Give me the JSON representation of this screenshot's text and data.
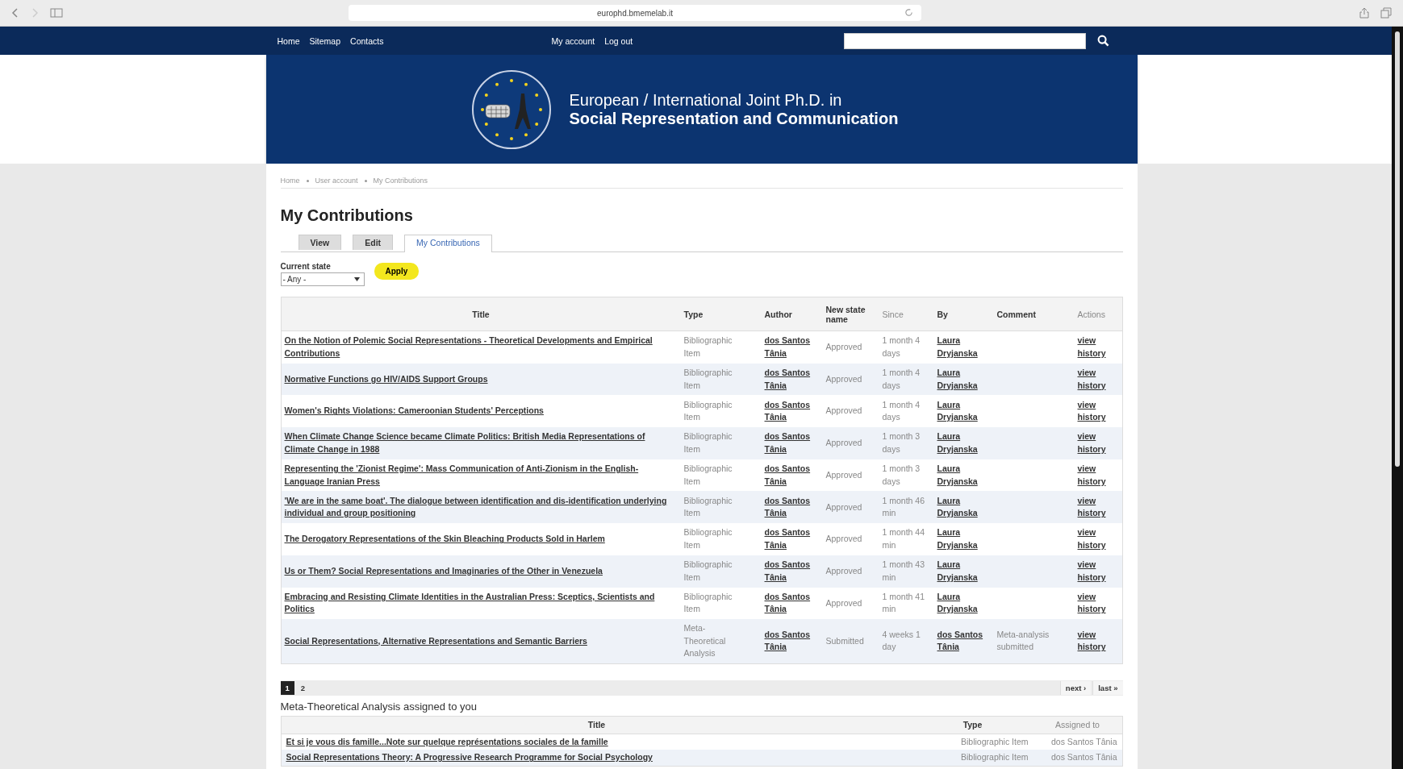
{
  "browser": {
    "url": "europhd.bmemelab.it"
  },
  "nav": {
    "links": [
      "Home",
      "Sitemap",
      "Contacts"
    ],
    "account_links": [
      "My account",
      "Log out"
    ]
  },
  "header": {
    "line1": "European / International Joint Ph.D. in",
    "line2": "Social Representation and Communication"
  },
  "breadcrumb": [
    "Home",
    "User account",
    "My Contributions"
  ],
  "page_title": "My Contributions",
  "tabs": [
    {
      "label": "View",
      "selected": false
    },
    {
      "label": "Edit",
      "selected": false
    },
    {
      "label": "My Contributions",
      "selected": true
    }
  ],
  "filter": {
    "label": "Current state",
    "value": "- Any -",
    "button": "Apply"
  },
  "contributions": {
    "columns": [
      {
        "label": "Title",
        "bold": true
      },
      {
        "label": "Type",
        "bold": true
      },
      {
        "label": "Author",
        "bold": true
      },
      {
        "label": "New state name",
        "bold": true
      },
      {
        "label": "Since",
        "bold": false
      },
      {
        "label": "By",
        "bold": true
      },
      {
        "label": "Comment",
        "bold": true
      },
      {
        "label": "Actions",
        "bold": false
      }
    ],
    "rows": [
      {
        "title": "On the Notion of Polemic Social Representations - Theoretical Developments and Empirical Contributions",
        "type": "Bibliographic Item",
        "author": "dos Santos Tânia",
        "state": "Approved",
        "since": "1 month 4 days",
        "by": "Laura Dryjanska",
        "comment": "",
        "action": "view history"
      },
      {
        "title": "Normative Functions go HIV/AIDS Support Groups",
        "type": "Bibliographic Item",
        "author": "dos Santos Tânia",
        "state": "Approved",
        "since": "1 month 4 days",
        "by": "Laura Dryjanska",
        "comment": "",
        "action": "view history"
      },
      {
        "title": "Women's Rights Violations: Cameroonian Students' Perceptions",
        "type": "Bibliographic Item",
        "author": "dos Santos Tânia",
        "state": "Approved",
        "since": "1 month 4 days",
        "by": "Laura Dryjanska",
        "comment": "",
        "action": "view history"
      },
      {
        "title": "When Climate Change Science became Climate Politics: British Media Representations of Climate Change in 1988",
        "type": "Bibliographic Item",
        "author": "dos Santos Tânia",
        "state": "Approved",
        "since": "1 month 3 days",
        "by": "Laura Dryjanska",
        "comment": "",
        "action": "view history"
      },
      {
        "title": "Representing the 'Zionist Regime': Mass Communication of Anti-Zionism in the English-Language Iranian Press",
        "type": "Bibliographic Item",
        "author": "dos Santos Tânia",
        "state": "Approved",
        "since": "1 month 3 days",
        "by": "Laura Dryjanska",
        "comment": "",
        "action": "view history"
      },
      {
        "title": "'We are in the same boat'. The dialogue between identification and dis-identification underlying individual and group positioning",
        "type": "Bibliographic Item",
        "author": "dos Santos Tânia",
        "state": "Approved",
        "since": "1 month 46 min",
        "by": "Laura Dryjanska",
        "comment": "",
        "action": "view history"
      },
      {
        "title": "The Derogatory Representations of the Skin Bleaching Products Sold in Harlem",
        "type": "Bibliographic Item",
        "author": "dos Santos Tânia",
        "state": "Approved",
        "since": "1 month 44 min",
        "by": "Laura Dryjanska",
        "comment": "",
        "action": "view history"
      },
      {
        "title": "Us or Them? Social Representations and Imaginaries of the Other in Venezuela",
        "type": "Bibliographic Item",
        "author": "dos Santos Tânia",
        "state": "Approved",
        "since": "1 month 43 min",
        "by": "Laura Dryjanska",
        "comment": "",
        "action": "view history"
      },
      {
        "title": "Embracing and Resisting Climate Identities in the Australian Press: Sceptics, Scientists and Politics",
        "type": "Bibliographic Item",
        "author": "dos Santos Tânia",
        "state": "Approved",
        "since": "1 month 41 min",
        "by": "Laura Dryjanska",
        "comment": "",
        "action": "view history"
      },
      {
        "title": "Social Representations, Alternative Representations and Semantic Barriers",
        "type": "Meta-Theoretical Analysis",
        "author": "dos Santos Tânia",
        "state": "Submitted",
        "since": "4 weeks 1 day",
        "by": "dos Santos Tânia",
        "comment": "Meta-analysis submitted",
        "action": "view history"
      }
    ]
  },
  "pager": {
    "pages": [
      {
        "label": "1",
        "selected": true
      },
      {
        "label": "2",
        "selected": false
      }
    ],
    "next": "next ›",
    "last": "last »"
  },
  "assigned": {
    "heading": "Meta-Theoretical Analysis assigned to you",
    "columns": [
      {
        "label": "Title",
        "bold": true
      },
      {
        "label": "Type",
        "bold": true
      },
      {
        "label": "Assigned to",
        "bold": false
      }
    ],
    "rows": [
      {
        "title": "Et si je vous dis famille...Note sur quelque représentations sociales de la famille",
        "type": "Bibliographic Item",
        "assigned_to": "dos Santos Tânia"
      },
      {
        "title": "Social Representations Theory: A Progressive Research Programme for Social Psychology",
        "type": "Bibliographic Item",
        "assigned_to": "dos Santos Tânia"
      }
    ]
  }
}
